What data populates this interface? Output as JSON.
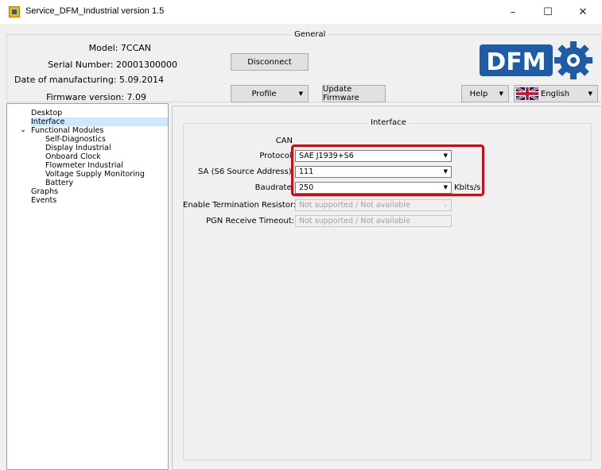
{
  "window": {
    "title": "Service_DFM_Industrial version 1.5",
    "controls": {
      "minimize": "–",
      "maximize": "☐",
      "close": "✕"
    }
  },
  "general": {
    "group_title": "General",
    "model": "Model: 7CCAN",
    "serial": "Serial Number: 20001300000",
    "manufacture_date": "Date of manufacturing: 5.09.2014",
    "firmware": "Firmware version: 7.09",
    "disconnect_label": "Disconnect",
    "profile_label": "Profile",
    "update_label": "Update Firmware",
    "help_label": "Help",
    "language_label": "English",
    "logo_text": "DFM"
  },
  "tree": {
    "items": [
      {
        "label": "Desktop"
      },
      {
        "label": "Interface"
      },
      {
        "label": "Functional Modules",
        "expander": "⌄"
      },
      {
        "label": "Self-Diagnostics"
      },
      {
        "label": "Display Industrial"
      },
      {
        "label": "Onboard Clock"
      },
      {
        "label": "Flowmeter Industrial"
      },
      {
        "label": "Voltage Supply Monitoring"
      },
      {
        "label": "Battery"
      },
      {
        "label": "Graphs"
      },
      {
        "label": "Events"
      }
    ]
  },
  "interface": {
    "group_title": "Interface",
    "can_label": "CAN",
    "protocol_label": "Protocol:",
    "protocol_value": "SAE J1939+S6",
    "sa_label": "SA (S6 Source Address):",
    "sa_value": "111",
    "baudrate_label": "Baudrate:",
    "baudrate_value": "250",
    "baudrate_unit": "Kbits/s",
    "termination_label": "Enable Termination Resistor:",
    "termination_value": "Not supported / Not available",
    "pgn_label": "PGN Receive Timeout:",
    "pgn_value": "Not supported / Not available"
  },
  "colors": {
    "highlight": "#c0111b",
    "logo_blue": "#1f5ca8",
    "selection": "#cce8ff"
  }
}
